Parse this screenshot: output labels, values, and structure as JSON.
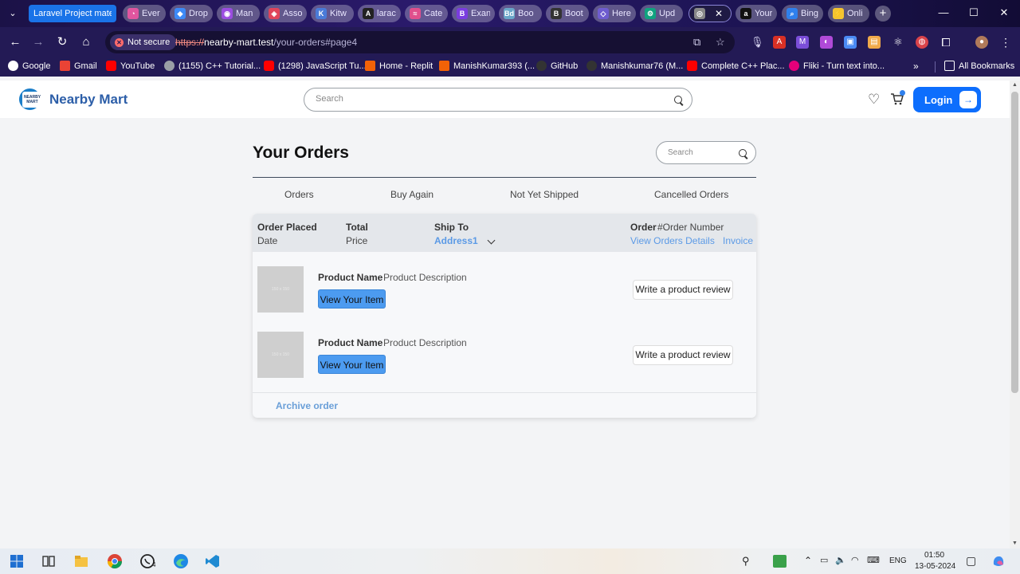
{
  "browser": {
    "tabs": [
      {
        "label": "Laravel Project materi",
        "color": "#1a73e8",
        "glyph": ""
      },
      {
        "label": "Ever",
        "color": "#e0559f",
        "glyph": "◔"
      },
      {
        "label": "Drop",
        "color": "#3d8af7",
        "glyph": "◆"
      },
      {
        "label": "Man",
        "color": "#9b4de0",
        "glyph": "◉"
      },
      {
        "label": "Asso",
        "color": "#e0445a",
        "glyph": "◈"
      },
      {
        "label": "Kitw",
        "color": "#4a7bd8",
        "glyph": "K"
      },
      {
        "label": "larac",
        "color": "#222222",
        "glyph": "A"
      },
      {
        "label": "Cate",
        "color": "#e04f8c",
        "glyph": "≈"
      },
      {
        "label": "Exan",
        "color": "#7a3ce0",
        "glyph": "B"
      },
      {
        "label": "Boo",
        "color": "#6aa7c9",
        "glyph": "Bd"
      },
      {
        "label": "Boot",
        "color": "#333333",
        "glyph": "B"
      },
      {
        "label": "Here",
        "color": "#6e5ccf",
        "glyph": "◇"
      },
      {
        "label": "Upd",
        "color": "#10a37f",
        "glyph": "⚙"
      },
      {
        "label": "",
        "color": "#888888",
        "glyph": "◎",
        "active": true
      },
      {
        "label": "Your",
        "color": "#111111",
        "glyph": "a"
      },
      {
        "label": "Bing",
        "color": "#2f80ed",
        "glyph": "⌕"
      },
      {
        "label": "Onli",
        "color": "#f4c430",
        "glyph": "⚡"
      }
    ],
    "security_label": "Not secure",
    "url_proto": "https://",
    "url_host": "nearby-mart.test",
    "url_path": "/your-orders#page4",
    "bookmarks": [
      {
        "label": "Google",
        "color": "#ffffff"
      },
      {
        "label": "Gmail",
        "color": "#ea4335"
      },
      {
        "label": "YouTube",
        "color": "#ff0000"
      },
      {
        "label": "(1155) C++ Tutorial...",
        "color": "#9aa0a6"
      },
      {
        "label": "(1298) JavaScript Tu...",
        "color": "#ff0000"
      },
      {
        "label": "Home - Replit",
        "color": "#f26207"
      },
      {
        "label": "ManishKumar393 (...",
        "color": "#f26207"
      },
      {
        "label": "GitHub",
        "color": "#333333"
      },
      {
        "label": "Manishkumar76 (M...",
        "color": "#333333"
      },
      {
        "label": "Complete C++ Plac...",
        "color": "#ff0000"
      },
      {
        "label": "Fliki - Turn text into...",
        "color": "#e6007a"
      }
    ],
    "all_bookmarks_label": "All Bookmarks"
  },
  "site": {
    "brand": "Nearby Mart",
    "logo_text": "NEARBY MART",
    "search_placeholder": "Search",
    "login_label": "Login"
  },
  "orders": {
    "title": "Your Orders",
    "search_placeholder": "Search",
    "tabs": [
      "Orders",
      "Buy Again",
      "Not Yet Shipped",
      "Cancelled Orders"
    ],
    "header": {
      "placed_label": "Order Placed",
      "placed_value": "Date",
      "total_label": "Total",
      "total_value": "Price",
      "ship_label": "Ship To",
      "ship_value": "Address1",
      "order_label": "Order",
      "order_value": "#Order Number",
      "details_link": "View Orders Details",
      "invoice_link": "Invoice"
    },
    "items": [
      {
        "image_text": "150 x 150",
        "name": "Product Name",
        "description": "Product Description",
        "view_label": "View Your Item",
        "review_label": "Write a product review"
      },
      {
        "image_text": "150 x 150",
        "name": "Product Name",
        "description": "Product Description",
        "view_label": "View Your Item",
        "review_label": "Write a product review"
      }
    ],
    "archive_label": "Archive order"
  },
  "taskbar": {
    "time": "01:50",
    "date": "13-05-2024",
    "lang": "ENG",
    "whatsapp_badge": "4"
  }
}
